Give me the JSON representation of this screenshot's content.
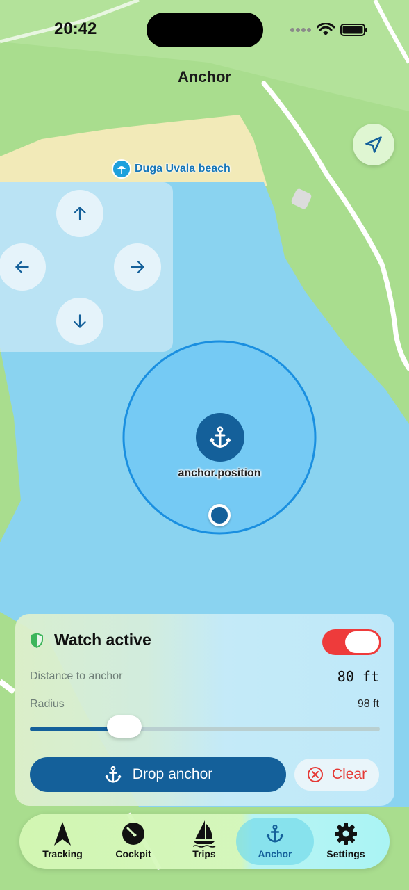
{
  "status_bar": {
    "time": "20:42"
  },
  "header": {
    "title": "Anchor"
  },
  "map": {
    "poi_label": "Duga Uvala beach",
    "anchor_label": "anchor.position"
  },
  "watch": {
    "title": "Watch active",
    "enabled": true,
    "distance_label": "Distance to anchor",
    "distance_value": "80 ft",
    "radius_label": "Radius",
    "radius_value": "98 ft",
    "radius_slider_fraction": 0.27
  },
  "actions": {
    "drop_label": "Drop anchor",
    "clear_label": "Clear"
  },
  "tabs": [
    {
      "label": "Tracking",
      "icon": "navigation-arrow-icon",
      "active": false
    },
    {
      "label": "Cockpit",
      "icon": "gauge-icon",
      "active": false
    },
    {
      "label": "Trips",
      "icon": "sailboat-icon",
      "active": false
    },
    {
      "label": "Anchor",
      "icon": "anchor-icon",
      "active": true
    },
    {
      "label": "Settings",
      "icon": "gear-icon",
      "active": false
    }
  ],
  "colors": {
    "primary": "#14609a",
    "danger": "#e53935",
    "toggle_on": "#ee3b3b",
    "water": "#8ad3f0",
    "land": "#a9dd8e",
    "sand": "#f2eab8"
  }
}
